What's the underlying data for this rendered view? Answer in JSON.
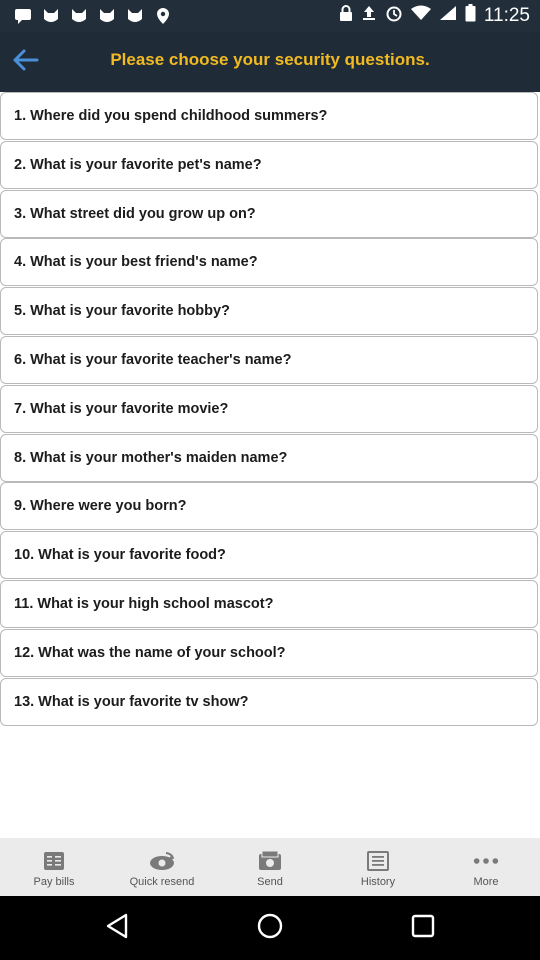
{
  "status_bar": {
    "time": "11:25",
    "icons": [
      "message-icon",
      "cat-icon",
      "cat-icon",
      "cat-icon",
      "cat-icon",
      "location-icon",
      "lock-icon",
      "upload-icon",
      "alarm-icon",
      "wifi-icon",
      "signal-icon",
      "battery-icon"
    ]
  },
  "header": {
    "title": "Please choose your security questions.",
    "back_icon": "arrow-left-icon"
  },
  "questions": [
    "1. Where did you spend childhood summers?",
    "2. What is your favorite pet's name?",
    "3. What street did you grow up on?",
    "4. What is your best friend's name?",
    "5. What is your favorite hobby?",
    "6. What is your favorite teacher's name?",
    "7. What is your favorite movie?",
    "8. What is your mother's maiden name?",
    "9. Where were you born?",
    "10. What is your favorite food?",
    "11. What is your high school mascot?",
    "12. What was the name of your school?",
    "13. What is your favorite tv show?"
  ],
  "tabs": [
    {
      "label": "Pay bills",
      "icon": "bill-icon"
    },
    {
      "label": "Quick resend",
      "icon": "resend-icon"
    },
    {
      "label": "Send",
      "icon": "send-icon"
    },
    {
      "label": "History",
      "icon": "history-icon"
    },
    {
      "label": "More",
      "icon": "more-icon"
    }
  ],
  "colors": {
    "header_bg": "#1f2c38",
    "accent": "#f2ba22",
    "back_arrow": "#4a90d9"
  }
}
